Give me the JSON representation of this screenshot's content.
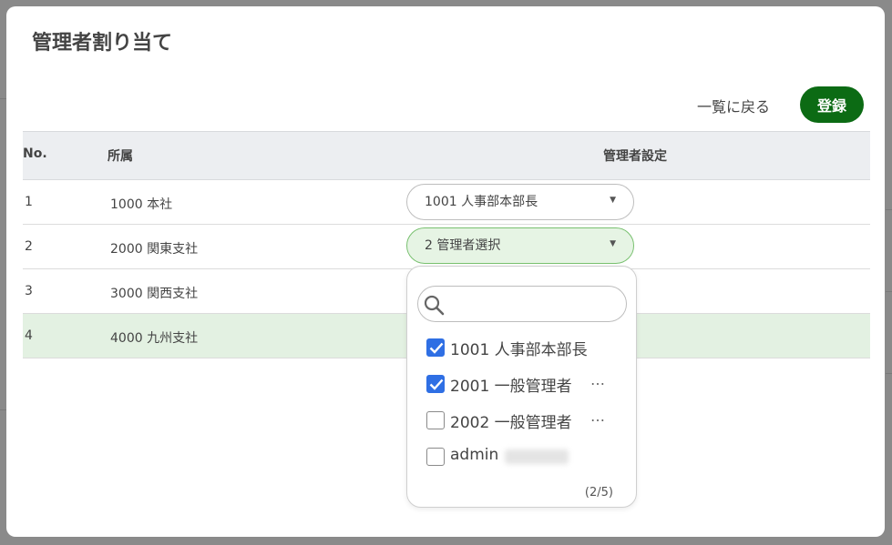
{
  "modal": {
    "title": "管理者割り当て",
    "back_label": "一覧に戻る",
    "submit_label": "登録"
  },
  "table": {
    "headers": {
      "no": "No.",
      "affiliation": "所属",
      "manager_setting": "管理者設定"
    },
    "rows": [
      {
        "no": "1",
        "affiliation": "1000 本社",
        "manager": "1001 人事部本部長"
      },
      {
        "no": "2",
        "affiliation": "2000 関東支社",
        "manager": "2 管理者選択"
      },
      {
        "no": "3",
        "affiliation": "3000 関西支社",
        "manager": ""
      },
      {
        "no": "4",
        "affiliation": "4000 九州支社",
        "manager": ""
      }
    ]
  },
  "dropdown": {
    "search_placeholder": "",
    "options": [
      {
        "label": "1001 人事部本部長",
        "checked": true,
        "has_more": false
      },
      {
        "label": "2001 一般管理者",
        "checked": true,
        "has_more": true,
        "more": "…"
      },
      {
        "label": "2002 一般管理者",
        "checked": false,
        "has_more": true,
        "more": "…"
      },
      {
        "label": "admin",
        "checked": false,
        "has_more": false,
        "redacted": true
      }
    ],
    "count": "(2/5)"
  },
  "colors": {
    "accent_green": "#0c6b14",
    "checkbox_blue": "#2f6fe4",
    "row_highlight": "#e3f1e2",
    "active_select_bg": "#e6f4e4"
  }
}
